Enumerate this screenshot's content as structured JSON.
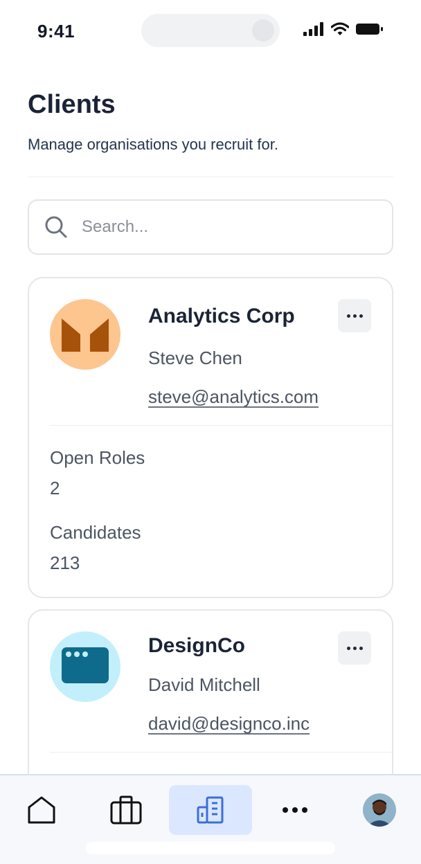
{
  "status_bar": {
    "time": "9:41"
  },
  "page": {
    "title": "Clients",
    "subtitle": "Manage organisations you recruit for."
  },
  "search": {
    "placeholder": "Search..."
  },
  "clients": [
    {
      "name": "Analytics Corp",
      "contact": "Steve Chen",
      "email": "steve@analytics.com",
      "logo_bg": "#fdc68f",
      "logo_fg": "#a7520a",
      "open_roles_label": "Open Roles",
      "open_roles": "2",
      "candidates_label": "Candidates",
      "candidates": "213"
    },
    {
      "name": "DesignCo",
      "contact": "David Mitchell",
      "email": "david@designco.inc",
      "logo_bg": "#c3effc",
      "logo_fg": "#0f6b8c"
    }
  ],
  "bottom_nav": {
    "items": [
      {
        "icon": "home-icon"
      },
      {
        "icon": "briefcase-icon"
      },
      {
        "icon": "building-icon",
        "active": true
      },
      {
        "icon": "more-horizontal-icon"
      },
      {
        "icon": "profile-avatar"
      }
    ],
    "active_color": "#dbe7ff",
    "accent": "#3b6fd6"
  }
}
